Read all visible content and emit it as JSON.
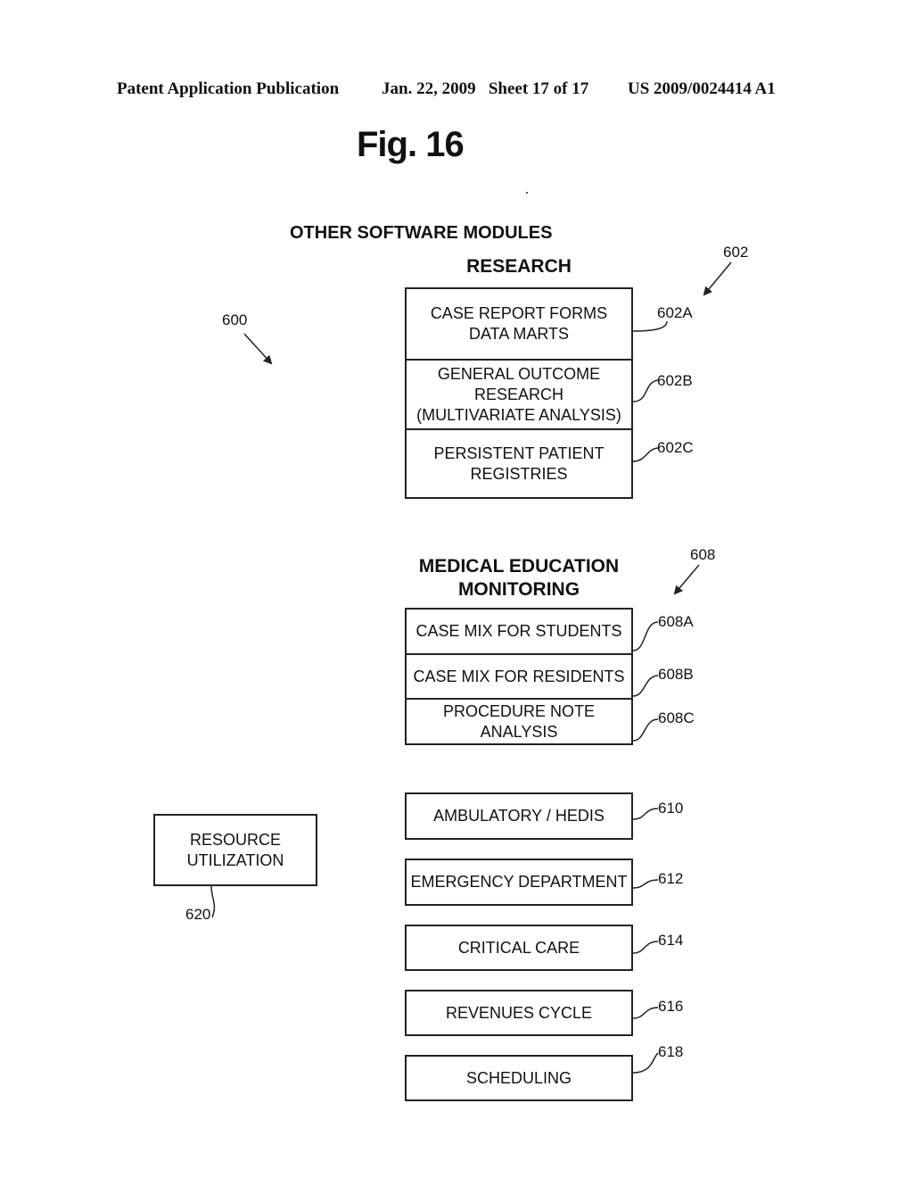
{
  "header": {
    "publication": "Patent Application Publication",
    "date_sheet": "Jan. 22, 2009   Sheet 17 of 17",
    "patent_number": "US 2009/0024414 A1"
  },
  "figure": {
    "title": "Fig. 16",
    "section_title": "OTHER SOFTWARE MODULES",
    "overall_ref": "600"
  },
  "research": {
    "heading": "RESEARCH",
    "ref": "602",
    "items": [
      {
        "label": "CASE REPORT FORMS\nDATA MARTS",
        "ref": "602A"
      },
      {
        "label": "GENERAL OUTCOME\nRESEARCH\n(MULTIVARIATE ANALYSIS)",
        "ref": "602B"
      },
      {
        "label": "PERSISTENT PATIENT\nREGISTRIES",
        "ref": "602C"
      }
    ]
  },
  "medical_education": {
    "heading": "MEDICAL EDUCATION\nMONITORING",
    "heading_line1": "MEDICAL EDUCATION",
    "heading_line2": "MONITORING",
    "ref": "608",
    "items": [
      {
        "label": "CASE MIX FOR STUDENTS",
        "ref": "608A"
      },
      {
        "label": "CASE MIX FOR RESIDENTS",
        "ref": "608B"
      },
      {
        "label": "PROCEDURE NOTE ANALYSIS",
        "ref": "608C"
      }
    ]
  },
  "modules": [
    {
      "label": "AMBULATORY / HEDIS",
      "ref": "610"
    },
    {
      "label": "EMERGENCY DEPARTMENT",
      "ref": "612"
    },
    {
      "label": "CRITICAL CARE",
      "ref": "614"
    },
    {
      "label": "REVENUES CYCLE",
      "ref": "616"
    },
    {
      "label": "SCHEDULING",
      "ref": "618"
    }
  ],
  "resource_utilization": {
    "label": "RESOURCE\nUTILIZATION",
    "ref": "620"
  }
}
